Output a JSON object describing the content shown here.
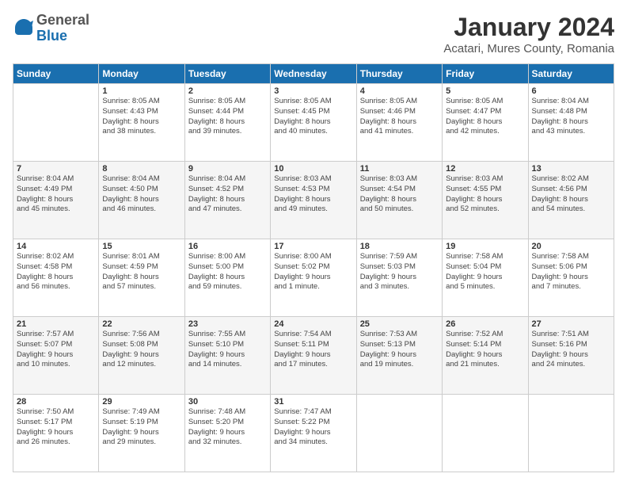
{
  "logo": {
    "general": "General",
    "blue": "Blue"
  },
  "header": {
    "title": "January 2024",
    "subtitle": "Acatari, Mures County, Romania"
  },
  "weekdays": [
    "Sunday",
    "Monday",
    "Tuesday",
    "Wednesday",
    "Thursday",
    "Friday",
    "Saturday"
  ],
  "weeks": [
    [
      {
        "day": "",
        "info": ""
      },
      {
        "day": "1",
        "info": "Sunrise: 8:05 AM\nSunset: 4:43 PM\nDaylight: 8 hours\nand 38 minutes."
      },
      {
        "day": "2",
        "info": "Sunrise: 8:05 AM\nSunset: 4:44 PM\nDaylight: 8 hours\nand 39 minutes."
      },
      {
        "day": "3",
        "info": "Sunrise: 8:05 AM\nSunset: 4:45 PM\nDaylight: 8 hours\nand 40 minutes."
      },
      {
        "day": "4",
        "info": "Sunrise: 8:05 AM\nSunset: 4:46 PM\nDaylight: 8 hours\nand 41 minutes."
      },
      {
        "day": "5",
        "info": "Sunrise: 8:05 AM\nSunset: 4:47 PM\nDaylight: 8 hours\nand 42 minutes."
      },
      {
        "day": "6",
        "info": "Sunrise: 8:04 AM\nSunset: 4:48 PM\nDaylight: 8 hours\nand 43 minutes."
      }
    ],
    [
      {
        "day": "7",
        "info": "Sunrise: 8:04 AM\nSunset: 4:49 PM\nDaylight: 8 hours\nand 45 minutes."
      },
      {
        "day": "8",
        "info": "Sunrise: 8:04 AM\nSunset: 4:50 PM\nDaylight: 8 hours\nand 46 minutes."
      },
      {
        "day": "9",
        "info": "Sunrise: 8:04 AM\nSunset: 4:52 PM\nDaylight: 8 hours\nand 47 minutes."
      },
      {
        "day": "10",
        "info": "Sunrise: 8:03 AM\nSunset: 4:53 PM\nDaylight: 8 hours\nand 49 minutes."
      },
      {
        "day": "11",
        "info": "Sunrise: 8:03 AM\nSunset: 4:54 PM\nDaylight: 8 hours\nand 50 minutes."
      },
      {
        "day": "12",
        "info": "Sunrise: 8:03 AM\nSunset: 4:55 PM\nDaylight: 8 hours\nand 52 minutes."
      },
      {
        "day": "13",
        "info": "Sunrise: 8:02 AM\nSunset: 4:56 PM\nDaylight: 8 hours\nand 54 minutes."
      }
    ],
    [
      {
        "day": "14",
        "info": "Sunrise: 8:02 AM\nSunset: 4:58 PM\nDaylight: 8 hours\nand 56 minutes."
      },
      {
        "day": "15",
        "info": "Sunrise: 8:01 AM\nSunset: 4:59 PM\nDaylight: 8 hours\nand 57 minutes."
      },
      {
        "day": "16",
        "info": "Sunrise: 8:00 AM\nSunset: 5:00 PM\nDaylight: 8 hours\nand 59 minutes."
      },
      {
        "day": "17",
        "info": "Sunrise: 8:00 AM\nSunset: 5:02 PM\nDaylight: 9 hours\nand 1 minute."
      },
      {
        "day": "18",
        "info": "Sunrise: 7:59 AM\nSunset: 5:03 PM\nDaylight: 9 hours\nand 3 minutes."
      },
      {
        "day": "19",
        "info": "Sunrise: 7:58 AM\nSunset: 5:04 PM\nDaylight: 9 hours\nand 5 minutes."
      },
      {
        "day": "20",
        "info": "Sunrise: 7:58 AM\nSunset: 5:06 PM\nDaylight: 9 hours\nand 7 minutes."
      }
    ],
    [
      {
        "day": "21",
        "info": "Sunrise: 7:57 AM\nSunset: 5:07 PM\nDaylight: 9 hours\nand 10 minutes."
      },
      {
        "day": "22",
        "info": "Sunrise: 7:56 AM\nSunset: 5:08 PM\nDaylight: 9 hours\nand 12 minutes."
      },
      {
        "day": "23",
        "info": "Sunrise: 7:55 AM\nSunset: 5:10 PM\nDaylight: 9 hours\nand 14 minutes."
      },
      {
        "day": "24",
        "info": "Sunrise: 7:54 AM\nSunset: 5:11 PM\nDaylight: 9 hours\nand 17 minutes."
      },
      {
        "day": "25",
        "info": "Sunrise: 7:53 AM\nSunset: 5:13 PM\nDaylight: 9 hours\nand 19 minutes."
      },
      {
        "day": "26",
        "info": "Sunrise: 7:52 AM\nSunset: 5:14 PM\nDaylight: 9 hours\nand 21 minutes."
      },
      {
        "day": "27",
        "info": "Sunrise: 7:51 AM\nSunset: 5:16 PM\nDaylight: 9 hours\nand 24 minutes."
      }
    ],
    [
      {
        "day": "28",
        "info": "Sunrise: 7:50 AM\nSunset: 5:17 PM\nDaylight: 9 hours\nand 26 minutes."
      },
      {
        "day": "29",
        "info": "Sunrise: 7:49 AM\nSunset: 5:19 PM\nDaylight: 9 hours\nand 29 minutes."
      },
      {
        "day": "30",
        "info": "Sunrise: 7:48 AM\nSunset: 5:20 PM\nDaylight: 9 hours\nand 32 minutes."
      },
      {
        "day": "31",
        "info": "Sunrise: 7:47 AM\nSunset: 5:22 PM\nDaylight: 9 hours\nand 34 minutes."
      },
      {
        "day": "",
        "info": ""
      },
      {
        "day": "",
        "info": ""
      },
      {
        "day": "",
        "info": ""
      }
    ]
  ]
}
